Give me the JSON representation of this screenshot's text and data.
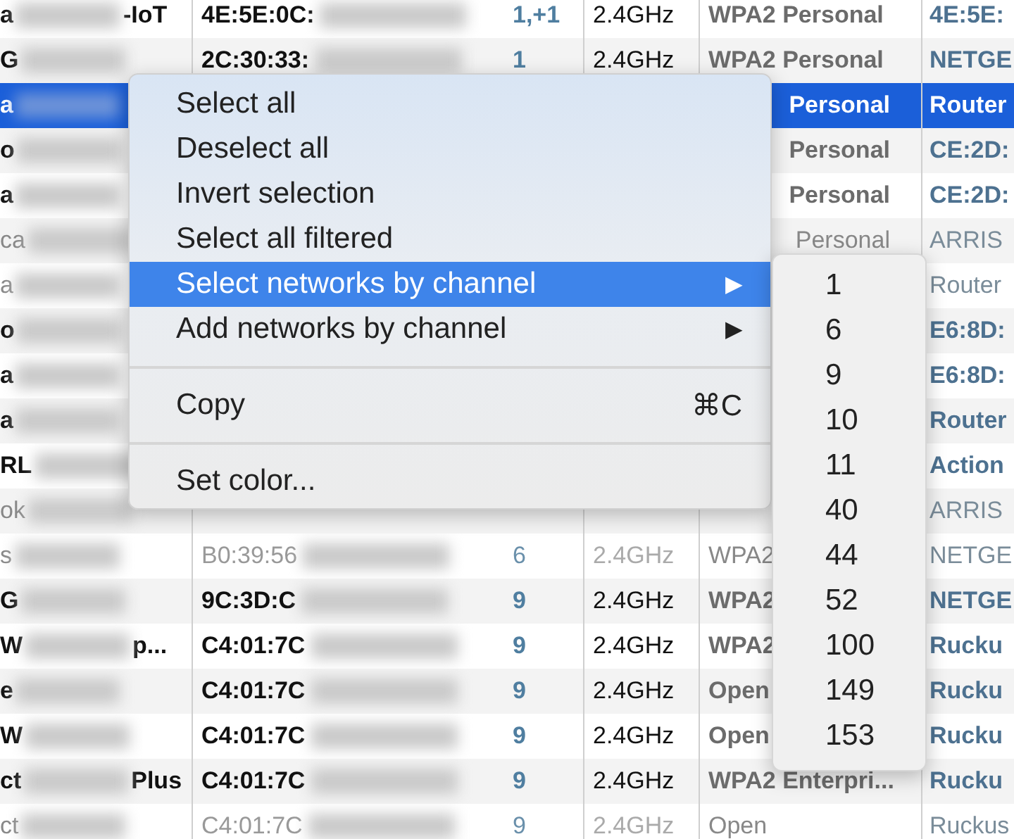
{
  "table": {
    "rows": [
      {
        "name_start": "a",
        "name_end": "-IoT",
        "mac": "4E:5E:0C:",
        "channel": "1,+1",
        "band": "2.4GHz",
        "security": "WPA2 Personal",
        "vendor": "4E:5E:",
        "dim": false,
        "selected": false
      },
      {
        "name_start": "G",
        "mac": "2C:30:33:",
        "channel": "1",
        "band": "2.4GHz",
        "security": "WPA2 Personal",
        "vendor": "NETGE",
        "dim": false,
        "selected": false
      },
      {
        "name_start": "a",
        "security_tail": "Personal",
        "vendor": "Router",
        "dim": false,
        "selected": true
      },
      {
        "name_start": "o",
        "security_tail": "Personal",
        "vendor": "CE:2D:",
        "dim": false,
        "selected": false
      },
      {
        "name_start": "a",
        "security_tail": "Personal",
        "vendor": "CE:2D:",
        "dim": false,
        "selected": false
      },
      {
        "name_start": "ca",
        "security_tail": "Personal",
        "vendor": "ARRIS",
        "dim": true,
        "selected": false
      },
      {
        "name_start": "a",
        "vendor": "Router",
        "dim": true,
        "selected": false
      },
      {
        "name_start": "o",
        "vendor": "E6:8D:",
        "dim": false,
        "selected": false
      },
      {
        "name_start": "a",
        "vendor": "E6:8D:",
        "dim": false,
        "selected": false
      },
      {
        "name_start": "a",
        "vendor": "Router",
        "dim": false,
        "selected": false
      },
      {
        "name_start": "RL",
        "vendor": "Action",
        "dim": false,
        "selected": false
      },
      {
        "name_start": "ok",
        "vendor": "ARRIS",
        "dim": true,
        "selected": false
      },
      {
        "name_start": "s",
        "mac": "B0:39:56",
        "channel": "6",
        "band": "2.4GHz",
        "security": "WPA2",
        "vendor": "NETGE",
        "dim": true,
        "selected": false
      },
      {
        "name_start": "G",
        "mac": "9C:3D:C",
        "channel": "9",
        "band": "2.4GHz",
        "security": "WPA2",
        "vendor": "NETGE",
        "dim": false,
        "selected": false
      },
      {
        "name_start": "W",
        "name_end": "p...",
        "mac": "C4:01:7C",
        "channel": "9",
        "band": "2.4GHz",
        "security": "WPA2",
        "vendor": "Rucku",
        "dim": false,
        "selected": false
      },
      {
        "name_start": "e",
        "mac": "C4:01:7C",
        "channel": "9",
        "band": "2.4GHz",
        "security": "Open",
        "vendor": "Rucku",
        "dim": false,
        "selected": false
      },
      {
        "name_start": "W",
        "mac": "C4:01:7C",
        "channel": "9",
        "band": "2.4GHz",
        "security": "Open",
        "vendor": "Rucku",
        "dim": false,
        "selected": false
      },
      {
        "name_start": "ct",
        "name_end": "Plus",
        "mac": "C4:01:7C",
        "channel": "9",
        "band": "2.4GHz",
        "security": "WPA2 Enterpri...",
        "vendor": "Rucku",
        "dim": false,
        "selected": false
      },
      {
        "name_start": "ct",
        "mac": "C4:01:7C",
        "channel": "9",
        "band": "2.4GHz",
        "security": "Open",
        "vendor": "Ruckus",
        "dim": true,
        "selected": false
      }
    ]
  },
  "context_menu": {
    "items": [
      {
        "kind": "item",
        "label": "Select all",
        "selected": false
      },
      {
        "kind": "item",
        "label": "Deselect all",
        "selected": false
      },
      {
        "kind": "item",
        "label": "Invert selection",
        "selected": false
      },
      {
        "kind": "item",
        "label": "Select all filtered",
        "selected": false
      },
      {
        "kind": "submenu",
        "label": "Select networks by channel",
        "arrow": "▶",
        "selected": true,
        "submenu": [
          "1",
          "6",
          "9",
          "10",
          "11",
          "40",
          "44",
          "52",
          "100",
          "149",
          "153"
        ]
      },
      {
        "kind": "submenu",
        "label": "Add networks by channel",
        "arrow": "▶",
        "selected": false
      },
      {
        "kind": "separator"
      },
      {
        "kind": "item",
        "label": "Copy",
        "shortcut": "⌘C",
        "selected": false
      },
      {
        "kind": "separator"
      },
      {
        "kind": "item",
        "label": "Set color...",
        "selected": false
      }
    ]
  }
}
